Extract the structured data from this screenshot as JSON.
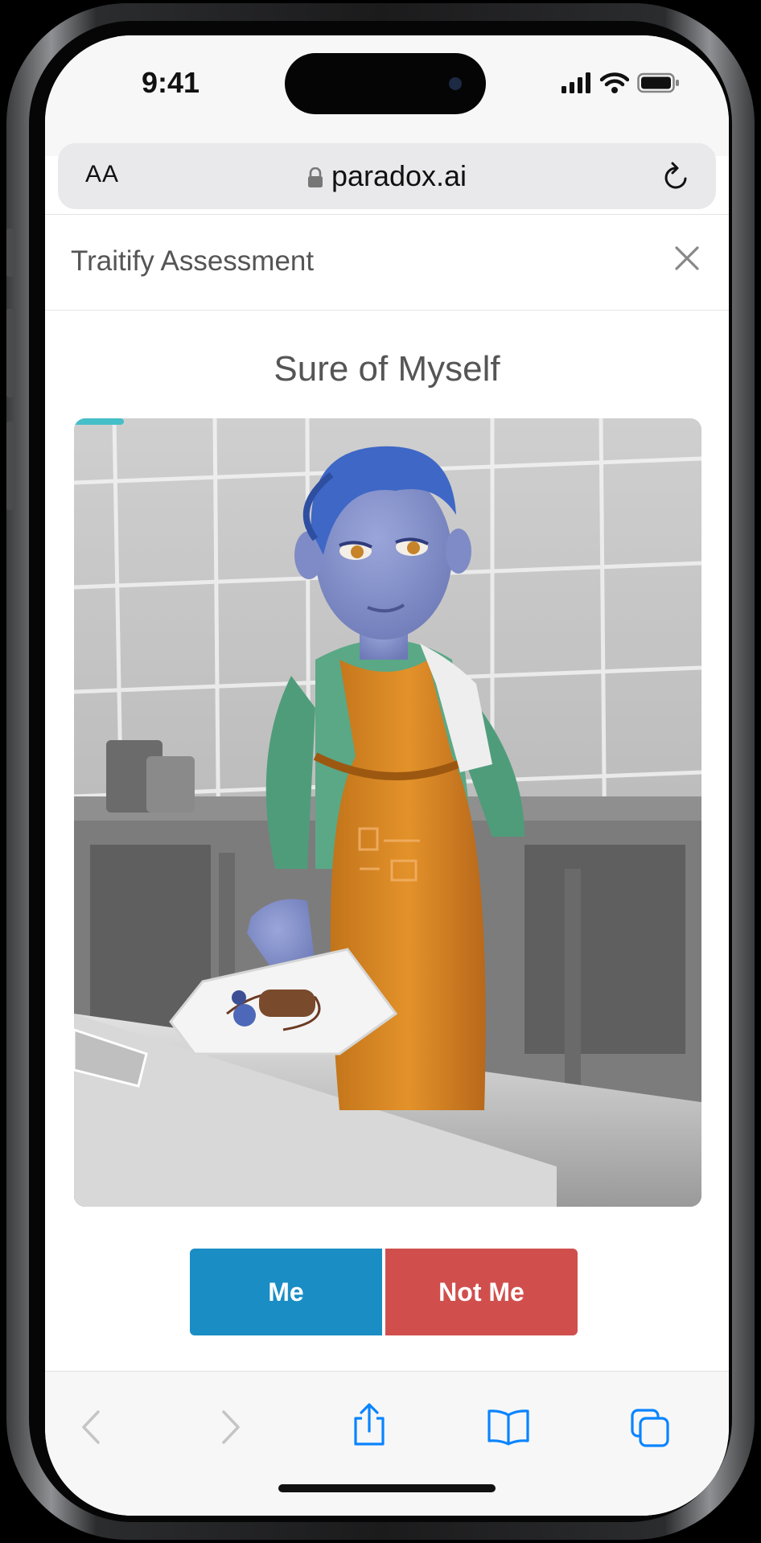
{
  "status_bar": {
    "time": "9:41"
  },
  "browser": {
    "text_size_label": "AA",
    "url": "paradox.ai"
  },
  "page": {
    "title": "Traitify Assessment"
  },
  "assessment": {
    "prompt": "Sure of Myself",
    "progress": 0.08,
    "image_description": "3D character in a kitchen wearing an orange apron presenting a plated dessert",
    "me_label": "Me",
    "not_me_label": "Not Me"
  },
  "colors": {
    "me_button": "#1a8ec4",
    "not_me_button": "#d04f4d",
    "progress": "#46bfc8",
    "ios_blue": "#0a84ff"
  },
  "toolbar_icons": [
    "back-icon",
    "forward-icon",
    "share-icon",
    "bookmarks-icon",
    "tabs-icon"
  ]
}
